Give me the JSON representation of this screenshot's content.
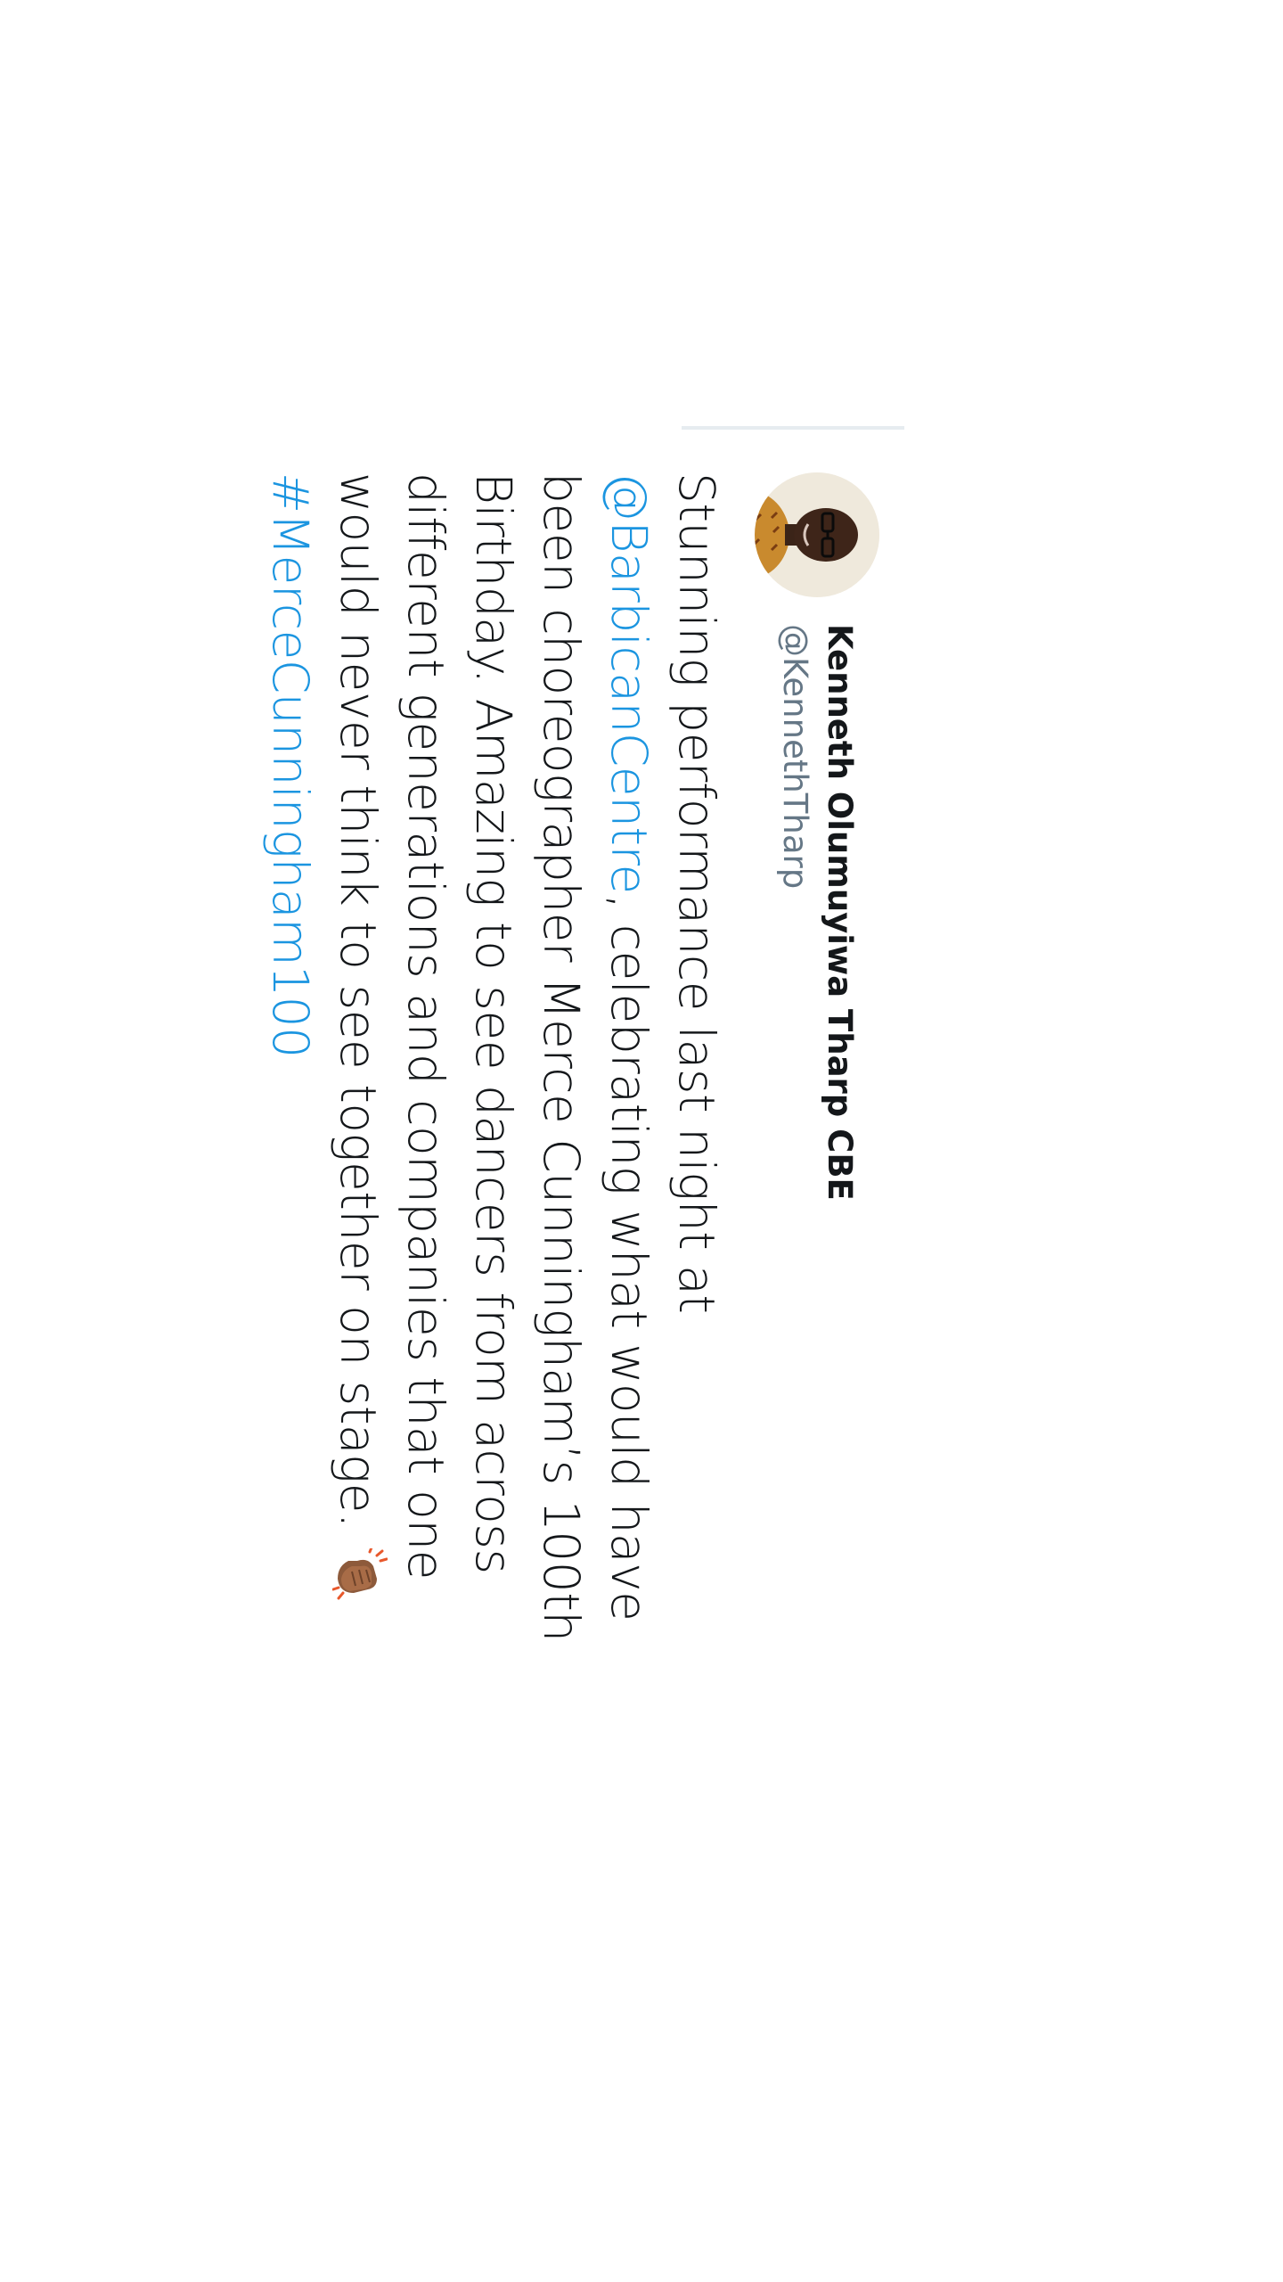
{
  "tweet": {
    "author": {
      "display_name": "Kenneth Olumuyiwa Tharp CBE",
      "handle": "@KennethTharp",
      "avatar_icon": "profile-photo"
    },
    "text_parts": {
      "p1": "Stunning performance last night at ",
      "mention": "@BarbicanCentre",
      "p2": ", celebrating what would have been choreographer Merce Cunningham’s 100th Birthday. Amazing to see dancers from across different generations and companies that one would never think to see together on stage. ",
      "emoji": "clapping-hands-medium-dark-skin-tone",
      "hashtag": "#MerceCunningham100"
    },
    "colors": {
      "link": "#1b95e0",
      "text": "#14171a",
      "secondary": "#657786",
      "divider": "#e6ecf0"
    }
  }
}
